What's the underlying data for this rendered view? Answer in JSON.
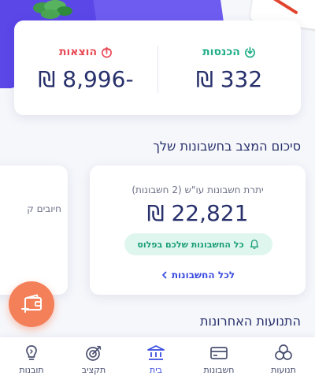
{
  "summary": {
    "income_label": "הכנסות",
    "income_amount": "332 ₪",
    "expense_label": "הוצאות",
    "expense_amount": "-8,996 ₪"
  },
  "accounts_section": {
    "title": "סיכום המצב בחשבונות שלך",
    "balance_subtitle": "יתרת חשבונות עו\"ש (2 חשבונות)",
    "balance_amount": "22,821 ₪",
    "status_text": "כל החשבונות שלכם בפלוס",
    "all_accounts_link": "לכל החשבונות",
    "side_card_text": "חיובים ק"
  },
  "recent_section": {
    "title": "התנועות האחרונות"
  },
  "bottom_nav": {
    "items": [
      {
        "label": "תנועות",
        "icon": "transactions-icon"
      },
      {
        "label": "חשבונות",
        "icon": "credit-card-icon"
      },
      {
        "label": "בית",
        "icon": "bank-icon"
      },
      {
        "label": "תקציב",
        "icon": "target-icon"
      },
      {
        "label": "תובנות",
        "icon": "lightbulb-icon"
      }
    ],
    "active": "בית"
  },
  "colors": {
    "income": "#1fae87",
    "expense": "#e94a55",
    "accent": "#3a4ce0",
    "fab": "#f4805a",
    "text": "#27306b"
  }
}
